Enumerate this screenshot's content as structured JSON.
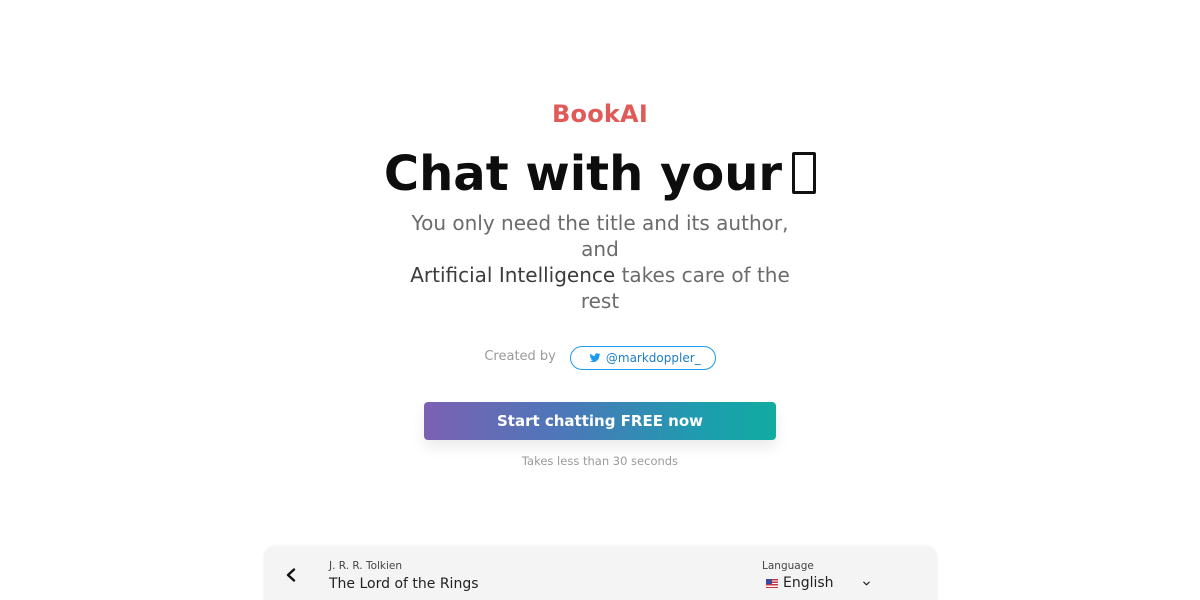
{
  "hero": {
    "brand": "BookAI",
    "headline": "Chat with your",
    "headline_icon": "book-icon",
    "subtitle_line1": "You only need the title and its author,",
    "subtitle_line2": "and",
    "subtitle_ai": "Artificial Intelligence",
    "subtitle_rest": " takes care of the",
    "subtitle_line4": "rest",
    "created_by_label": "Created by",
    "twitter_handle": "@markdoppler_",
    "cta_label": "Start chatting FREE now",
    "cta_note": "Takes less than 30 seconds"
  },
  "chat_header": {
    "author": "J. R. R. Tolkien",
    "title": "The Lord of the Rings",
    "language_label": "Language",
    "language_value": "English"
  },
  "colors": {
    "brand": "#e05a57",
    "cta_gradient_start": "#7b61b3",
    "cta_gradient_end": "#12aba0",
    "twitter": "#1d9bf0"
  }
}
